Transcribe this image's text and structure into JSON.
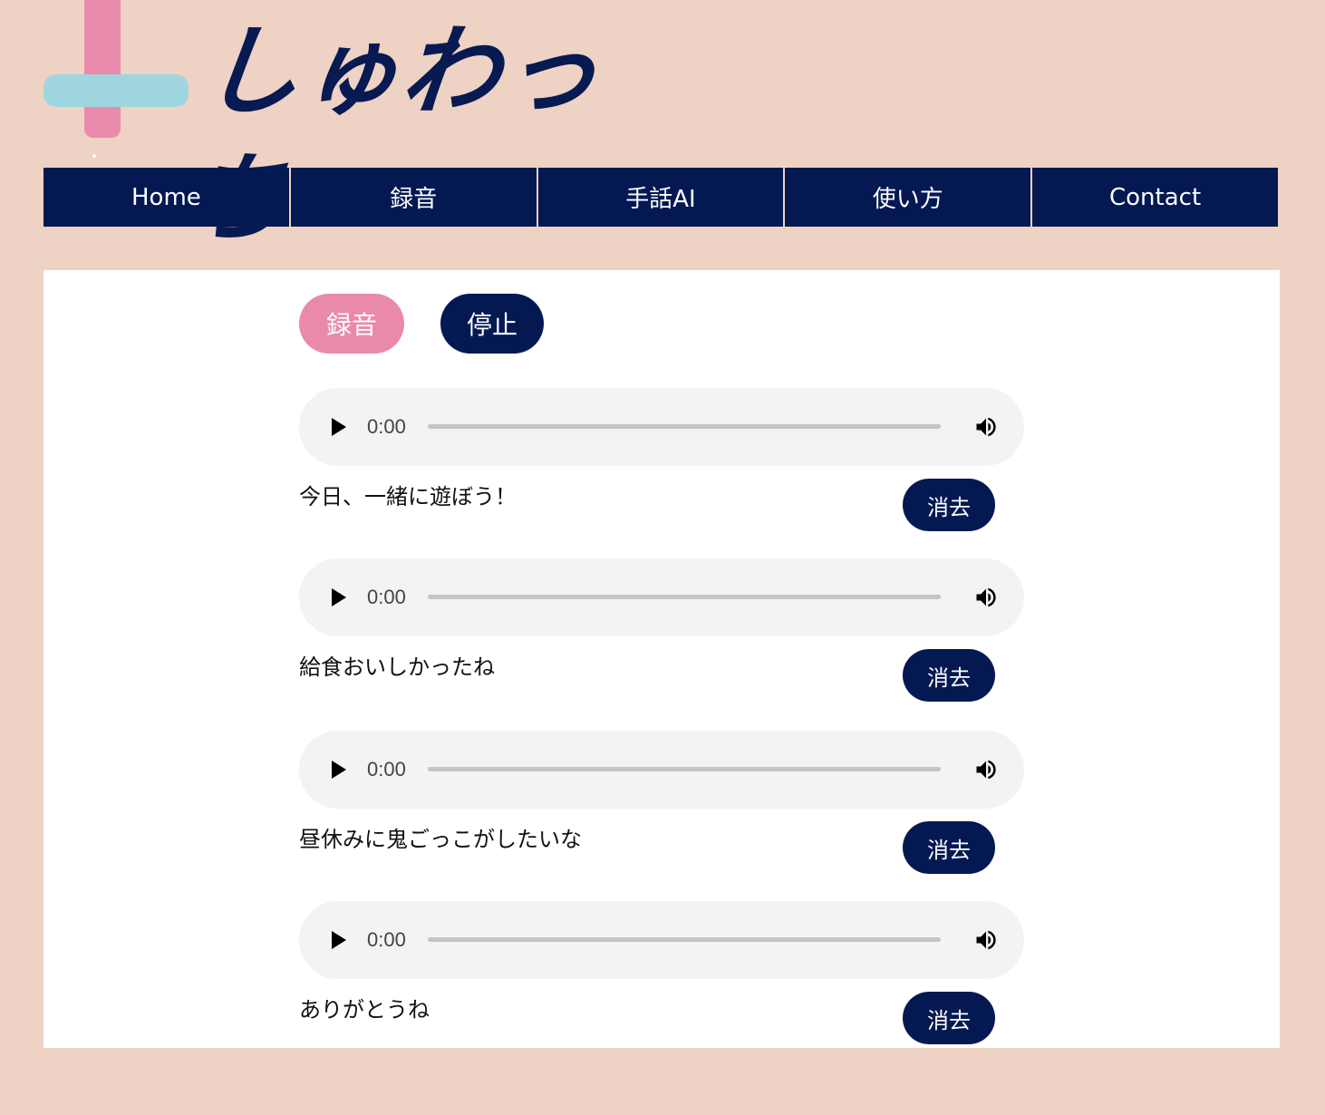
{
  "logo": {
    "text": "しゅわっち"
  },
  "nav": {
    "items": [
      {
        "label": "Home"
      },
      {
        "label": "録音"
      },
      {
        "label": "手話AI"
      },
      {
        "label": "使い方"
      },
      {
        "label": "Contact"
      }
    ]
  },
  "controls": {
    "record_label": "録音",
    "stop_label": "停止"
  },
  "recordings": [
    {
      "time": "0:00",
      "caption": "今日、一緒に遊ぼう！",
      "delete_label": "消去"
    },
    {
      "time": "0:00",
      "caption": "給食おいしかったね",
      "delete_label": "消去"
    },
    {
      "time": "0:00",
      "caption": "昼休みに鬼ごっこがしたいな",
      "delete_label": "消去"
    },
    {
      "time": "0:00",
      "caption": "ありがとうね",
      "delete_label": "消去"
    }
  ],
  "colors": {
    "background": "#eed2c3",
    "navy": "#041852",
    "pink": "#e98aac",
    "light_blue": "#9fd5df",
    "player_bg": "#f1f3f4"
  },
  "icons": {
    "play": "play-icon",
    "volume": "volume-icon"
  }
}
